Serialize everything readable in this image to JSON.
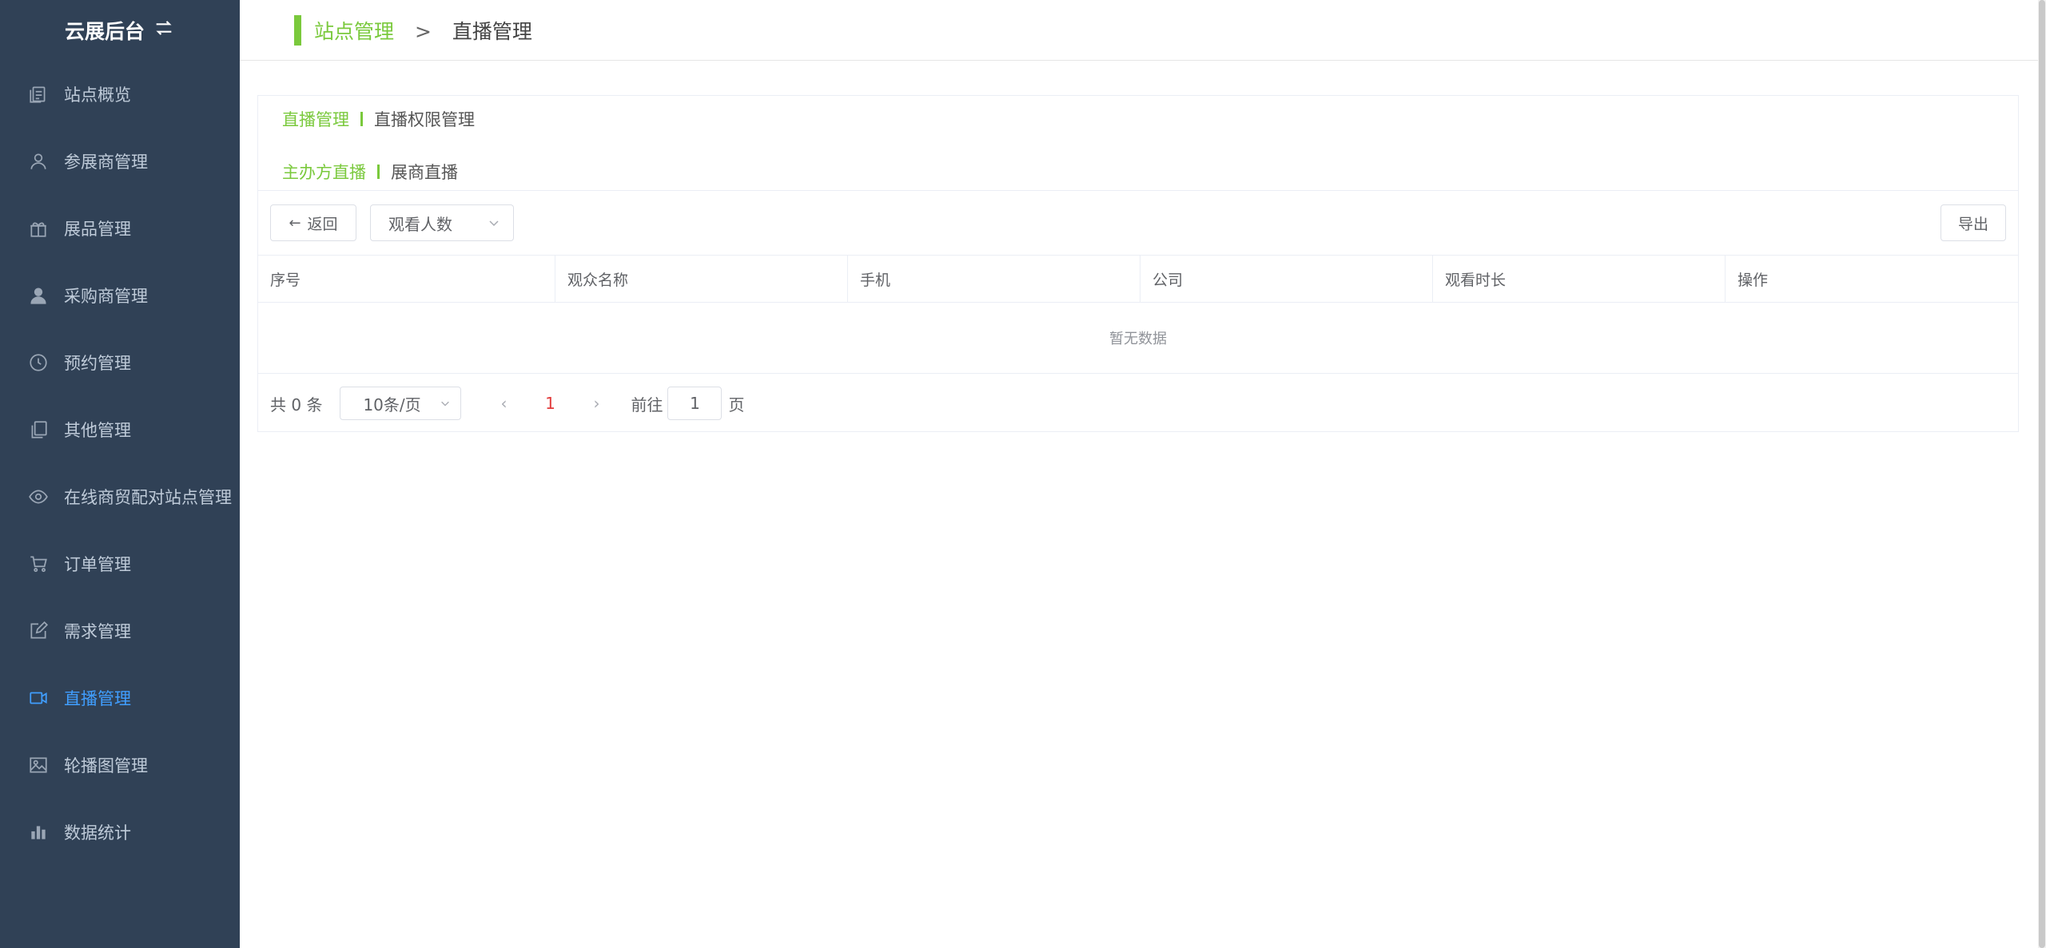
{
  "sidebar": {
    "brand": "云展后台",
    "items": [
      {
        "label": "站点概览",
        "icon": "document-icon"
      },
      {
        "label": "参展商管理",
        "icon": "user-outline-icon"
      },
      {
        "label": "展品管理",
        "icon": "gift-icon"
      },
      {
        "label": "采购商管理",
        "icon": "user-solid-icon"
      },
      {
        "label": "预约管理",
        "icon": "clock-icon"
      },
      {
        "label": "其他管理",
        "icon": "copy-icon"
      },
      {
        "label": "在线商贸配对站点管理",
        "icon": "eye-icon"
      },
      {
        "label": "订单管理",
        "icon": "cart-icon"
      },
      {
        "label": "需求管理",
        "icon": "edit-icon"
      },
      {
        "label": "直播管理",
        "icon": "video-camera-icon",
        "active": true
      },
      {
        "label": "轮播图管理",
        "icon": "picture-icon"
      },
      {
        "label": "数据统计",
        "icon": "bar-chart-icon"
      }
    ]
  },
  "header": {
    "crumb_link": "站点管理",
    "crumb_sep": ">",
    "crumb_current": "直播管理"
  },
  "tabs1": {
    "active": "直播管理",
    "other": "直播权限管理"
  },
  "tabs2": {
    "active": "主办方直播",
    "other": "展商直播"
  },
  "toolbar": {
    "back_label": "返回",
    "select_value": "观看人数",
    "export_label": "导出"
  },
  "table": {
    "columns": [
      "序号",
      "观众名称",
      "手机",
      "公司",
      "观看时长",
      "操作"
    ],
    "empty_text": "暂无数据"
  },
  "pager": {
    "total": "共 0 条",
    "page_size": "10条/页",
    "current_page": "1",
    "goto_label": "前往",
    "goto_value": "1",
    "page_suffix": "页"
  },
  "colors": {
    "sidebar_bg": "#304156",
    "accent_green": "#7ac93c",
    "active_blue": "#409eff"
  }
}
